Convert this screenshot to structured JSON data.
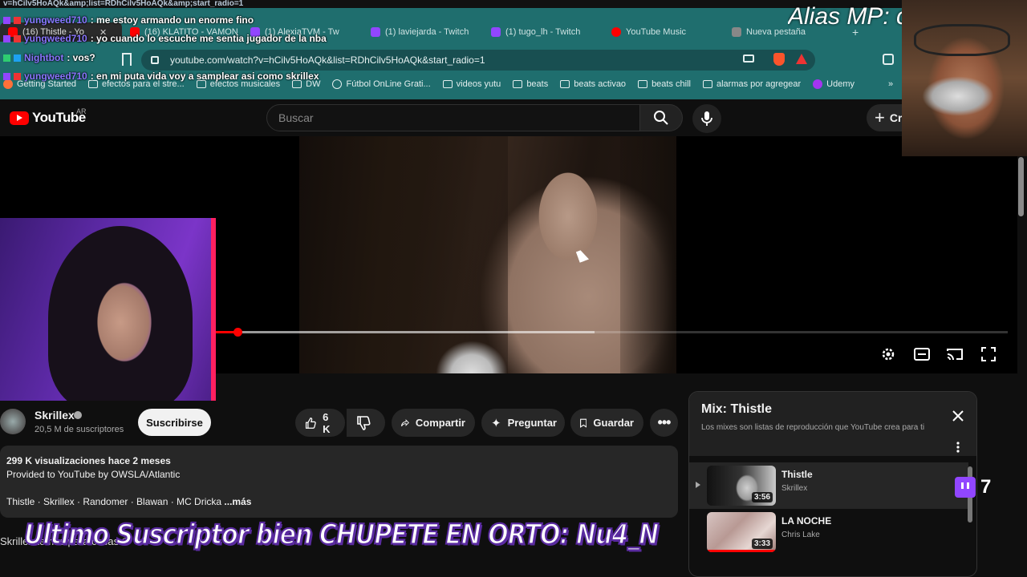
{
  "browser": {
    "url_strip": "v=hCilv5HoAQk&amp;list=RDhCilv5HoAQk&amp;start_radio=1",
    "tabs": [
      {
        "label": "(16) Thistle - Yo",
        "color": "#ff0000",
        "active": true
      },
      {
        "label": "(16) KLATITO - VAMON",
        "color": "#ff0000",
        "active": false
      },
      {
        "label": "(1) AlexiaTVM - Tw",
        "color": "#9146ff",
        "active": false
      },
      {
        "label": "(1) laviejarda - Twitch",
        "color": "#9146ff",
        "active": false
      },
      {
        "label": "(1) tugo_lh - Twitch",
        "color": "#9146ff",
        "active": false
      },
      {
        "label": "YouTube Music",
        "color": "#ff0000",
        "active": false
      },
      {
        "label": "Nueva pestaña",
        "color": "#888888",
        "active": false
      }
    ],
    "address": "youtube.com/watch?v=hCilv5HoAQk&list=RDhCilv5HoAQk&start_radio=1",
    "bookmarks": [
      {
        "label": "Getting Started",
        "icon": "firefox-icon"
      },
      {
        "label": "efectos para el stre...",
        "icon": "folder-icon"
      },
      {
        "label": "efectos musicales",
        "icon": "folder-icon"
      },
      {
        "label": "DW",
        "icon": "folder-icon"
      },
      {
        "label": "Fútbol OnLine Grati...",
        "icon": "globe-icon"
      },
      {
        "label": "videos yutu",
        "icon": "folder-icon"
      },
      {
        "label": "beats",
        "icon": "folder-icon"
      },
      {
        "label": "beats activao",
        "icon": "folder-icon"
      },
      {
        "label": "beats chill",
        "icon": "folder-icon"
      },
      {
        "label": "alarmas por agregear",
        "icon": "folder-icon"
      },
      {
        "label": "Udemy",
        "icon": "udemy-icon"
      }
    ]
  },
  "chat": [
    {
      "user": "yungweed710",
      "message": ": me estoy armando un enorme fino"
    },
    {
      "user": "yungweed710",
      "message": ": yo cuando lo escuche me sentia jugador de la nba"
    },
    {
      "user": "Nightbot",
      "message": ": vos?"
    },
    {
      "user": "yungweed710",
      "message": ": en mi puta vida voy a samplear asi como skrillex"
    }
  ],
  "overlay": {
    "alias": "Alias MP: c",
    "sub_banner": "Ultimo Suscriptor bien CHUPETE EN ORTO: Nu4_N",
    "twitch_count": "7"
  },
  "youtube": {
    "logo_text": "YouTube",
    "region": "AR",
    "search_placeholder": "Buscar",
    "create_label": "Cr",
    "progress": {
      "played": 0.003,
      "buffered": 0.45
    },
    "channel": {
      "name": "Skrillex",
      "subscribers": "20,5 M de suscriptores",
      "subscribe_label": "Suscribirse"
    },
    "actions": {
      "likes": "6 K",
      "share": "Compartir",
      "ask": "Preguntar",
      "save": "Guardar"
    },
    "description": {
      "stats": "299 K visualizaciones  hace 2 meses",
      "line2": "Provided to YouTube by OWSLA/Atlantic",
      "tags": "Thistle · Skrillex · Randomer · Blawan · MC Dricka",
      "more": " ...más"
    },
    "below_text": "Skrillex  temas  para  cosas  ©",
    "mix": {
      "title": "Mix: Thistle",
      "subtitle": "Los mixes son listas de reproducción que YouTube crea para ti",
      "items": [
        {
          "title": "Thistle",
          "artist": "Skrillex",
          "duration": "3:56"
        },
        {
          "title": "LA NOCHE",
          "artist": "Chris Lake",
          "duration": "3:33"
        }
      ]
    }
  }
}
